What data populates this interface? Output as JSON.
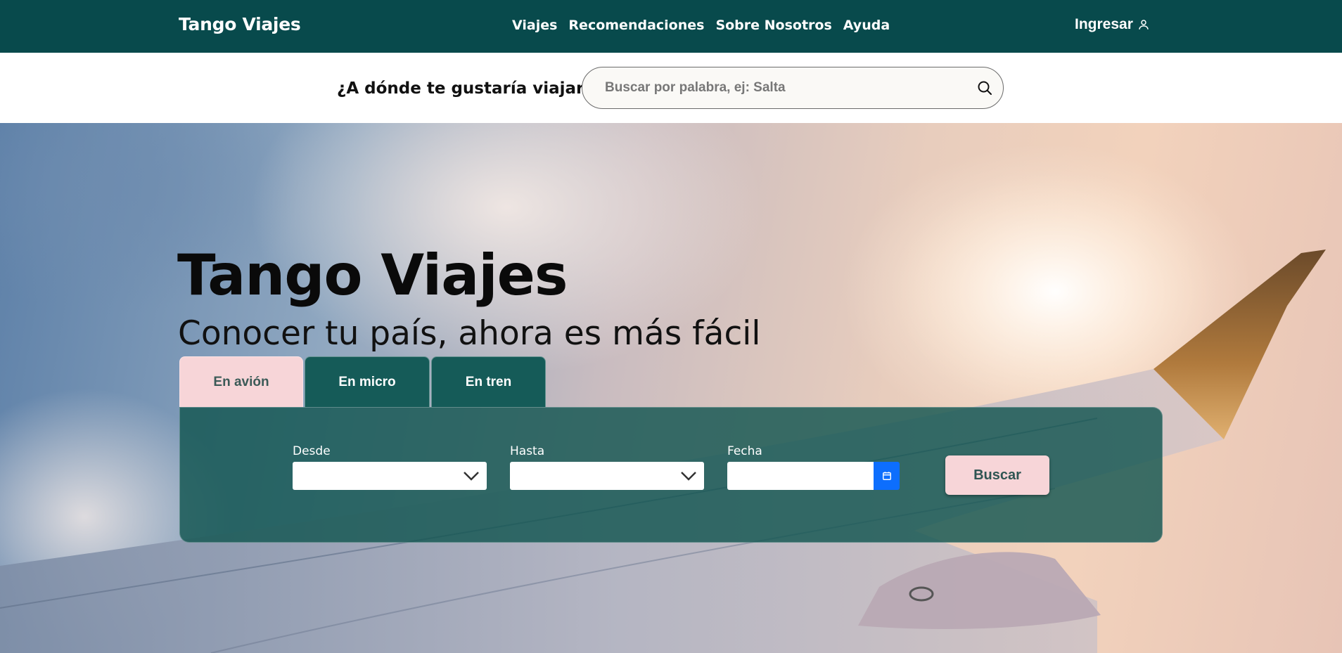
{
  "navbar": {
    "brand": "Tango Viajes",
    "links": [
      "Viajes",
      "Recomendaciones",
      "Sobre Nosotros",
      "Ayuda"
    ],
    "login_label": "Ingresar",
    "login_icon": "user-icon",
    "background_color": "#084a4c"
  },
  "search": {
    "question": "¿A dónde te gustaría viajar?",
    "placeholder": "Buscar por palabra, ej: Salta",
    "value": "",
    "icon": "search-icon"
  },
  "hero": {
    "title": "Tango Viajes",
    "subtitle": "Conocer tu país, ahora es más fácil"
  },
  "tabs": [
    {
      "label": "En avión",
      "active": true
    },
    {
      "label": "En micro",
      "active": false
    },
    {
      "label": "En tren",
      "active": false
    }
  ],
  "form": {
    "from_label": "Desde",
    "from_value": "",
    "to_label": "Hasta",
    "to_value": "",
    "date_label": "Fecha",
    "date_value": "",
    "calendar_icon": "calendar-icon",
    "submit_label": "Buscar",
    "accent_color": "#f7d5d8",
    "panel_color": "#125650"
  }
}
